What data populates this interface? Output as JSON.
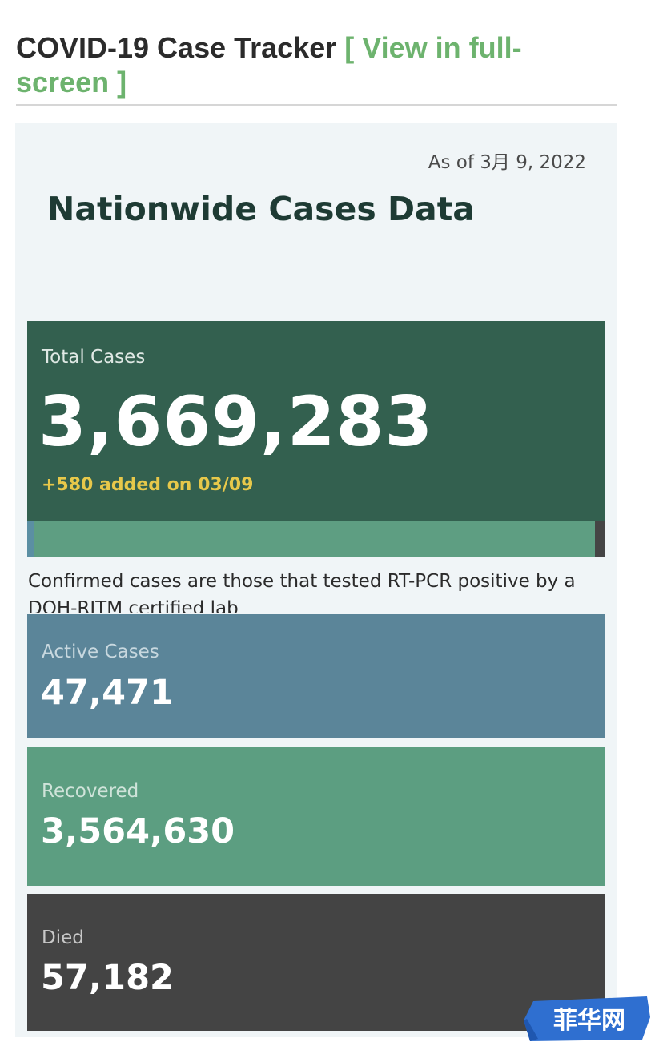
{
  "header": {
    "title": "COVID-19 Case Tracker",
    "link_label": "[ View in full-screen ]"
  },
  "dashboard": {
    "as_of": "As of 3月 9, 2022",
    "title": "Nationwide Cases Data",
    "total": {
      "label": "Total Cases",
      "value": "3,669,283",
      "added": "+580 added on 03/09"
    },
    "note": "Confirmed cases are those that tested RT-PCR positive by a DOH-RITM certified lab",
    "active": {
      "label": "Active Cases",
      "value": "47,471"
    },
    "recovered": {
      "label": "Recovered",
      "value": "3,564,630"
    },
    "died": {
      "label": "Died",
      "value": "57,182"
    }
  },
  "watermark": {
    "text": "菲华网"
  },
  "colors": {
    "link": "#6db36e",
    "total_card": "#33604f",
    "active_card": "#5b8599",
    "recovered_card": "#5c9e81",
    "died_card": "#444444",
    "added_text": "#e7c84a"
  }
}
